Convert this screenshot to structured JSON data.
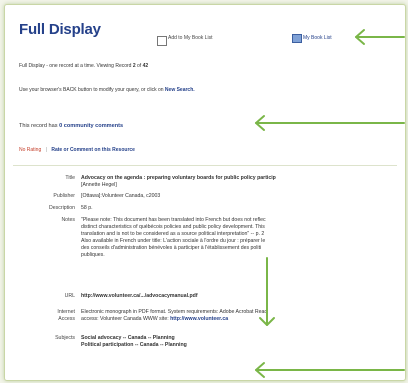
{
  "header": {
    "title": "Full Display",
    "add_label": "Add to My Book List",
    "booklist_label": "My Book List"
  },
  "intro": {
    "line1_prefix": "Full Display - one record at a time. Viewing Record ",
    "record_current": "2",
    "record_of": " of ",
    "record_total": "42",
    "line2_prefix": "Use your browser's BACK button to modify your query, or click on ",
    "new_search": "New Search."
  },
  "community": {
    "prefix": "This record has ",
    "link": "0 community comments"
  },
  "rating": {
    "no_rating": "No Rating",
    "sep": "|",
    "rate_link": "Rate or Comment on this Resource"
  },
  "record": {
    "title_label": "Title",
    "title_value": "Advocacy on the agenda : preparing voluntary boards for public policy particip",
    "title_author": "[Annette Hegel]",
    "publisher_label": "Publisher",
    "publisher_value": "[Ottawa]:Volunteer Canada, c2003",
    "description_label": "Description",
    "description_value": "58 p.",
    "notes_label": "Notes",
    "notes_lines": [
      "\"Please note: This document has been translated into French but does not reflec",
      "distinct characteristics of québécois policies and public policy development. This",
      "translation and is not to be considered as a source political interpretation\" -- p. 2",
      "Also available in French under title: L'action sociale à l'ordre du jour : préparer le",
      "des conseils d'administration bénévoles à participer à l'établissement des politi",
      "publiques."
    ],
    "url_label": "URL",
    "url_value": "http://www.volunteer.ca/.../advocacymanual.pdf",
    "internet_label_1": "Internet",
    "internet_label_2": "Access",
    "internet_line1": "Electronic monograph in PDF format. System requirements: Adobe Acrobat Read",
    "internet_line2_prefix": "access: Volunteer Canada WWW site: ",
    "internet_line2_link": "http://www.volunteer.ca",
    "subjects_label": "Subjects",
    "subject1": "Social advocacy -- Canada -- Planning",
    "subject2": "Political participation -- Canada -- Planning"
  },
  "colors": {
    "accent": "#25418a",
    "arrow": "#7ab648",
    "frame": "#c9d6a6",
    "rating": "#c5402c"
  }
}
